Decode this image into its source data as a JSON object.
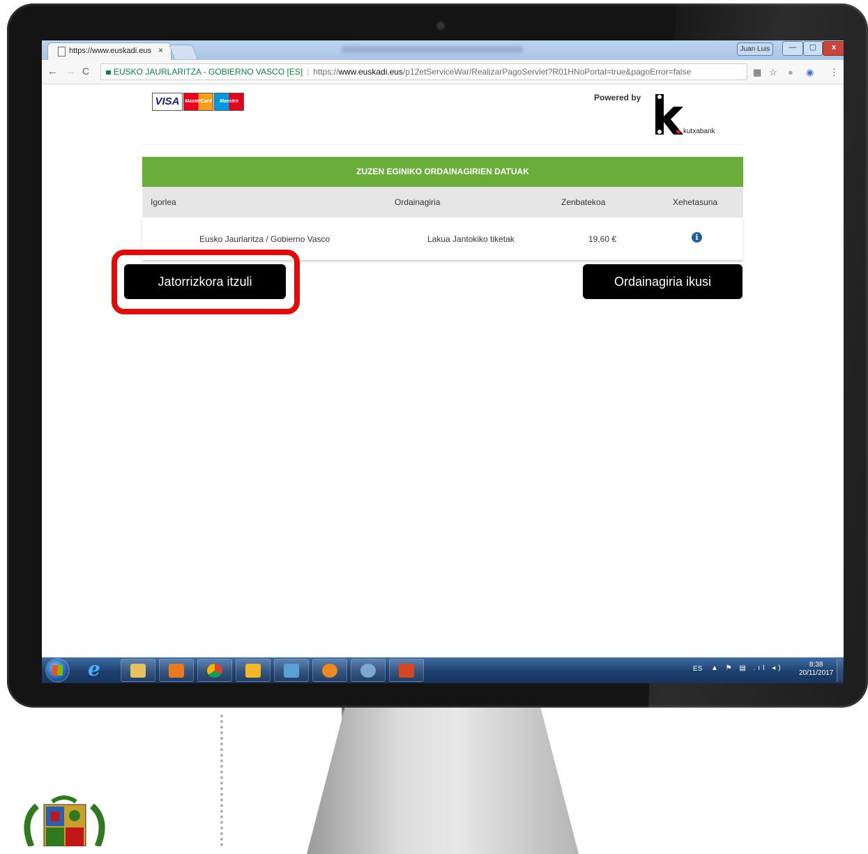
{
  "browser": {
    "tab_title": "https://www.euskadi.eus",
    "tab_close": "×",
    "user_name": "Juan Luis",
    "window_buttons": {
      "minimize": "—",
      "maximize": "▢",
      "close": "x"
    },
    "nav": {
      "back": "←",
      "forward": "→",
      "reload": "C"
    },
    "address": {
      "secure_label": "EUSKO JAURLARITZA - GOBIERNO VASCO [ES]",
      "url_scheme": "https://",
      "url_host": "www.euskadi.eus",
      "url_path": "/p12etServiceWar/RealizarPagoServlet?R01HNoPortal=true&pagoError=false"
    },
    "toolbar_icons": [
      "translate-icon",
      "star-icon",
      "extension-icon",
      "globe-icon",
      "menu-icon"
    ],
    "toolbar_glyphs": {
      "translate": "▦",
      "star": "☆",
      "extension": "●",
      "globe": "◉",
      "menu": "⋮"
    }
  },
  "page": {
    "card_logos": {
      "visa": "VISA",
      "mastercard": "MasterCard",
      "maestro": "Maestro"
    },
    "powered_by": "Powered by",
    "kutxabank": "kutxabank",
    "table": {
      "title": "ZUZEN EGINIKO ORDAINAGIRIEN DATUAK",
      "columns": [
        "Igorlea",
        "Ordainagiria",
        "Zenbatekoa",
        "Xehetasuna"
      ],
      "rows": [
        {
          "igorlea": "Eusko Jaurlaritza / Gobierno Vasco",
          "ordainagiria": "Lakua Jantokiko tiketak",
          "zenbatekoa": "19,60 €",
          "xehetasuna_icon": "info-icon"
        }
      ],
      "info_glyph": "i"
    },
    "buttons": {
      "back": "Jatorrizkora itzuli",
      "view_receipt": "Ordainagiria ikusi"
    },
    "highlight_color": "#e00b0b"
  },
  "taskbar": {
    "apps": [
      "start-icon",
      "internet-explorer-icon",
      "file-explorer-icon",
      "media-player-icon",
      "chrome-icon",
      "outlook-icon",
      "notes-icon",
      "butterfly-app-icon",
      "network-app-icon",
      "powerpoint-icon"
    ],
    "ie_glyph": "e",
    "language": "ES",
    "tray_icons": "▲ ⚑ ▤ .ıl ◂)",
    "time": "8:38",
    "date": "20/11/2017"
  },
  "colors": {
    "header_green": "#6aad3b",
    "header_gray": "#e6e6e6",
    "button_black": "#000000",
    "info_blue": "#1f5fa6"
  }
}
